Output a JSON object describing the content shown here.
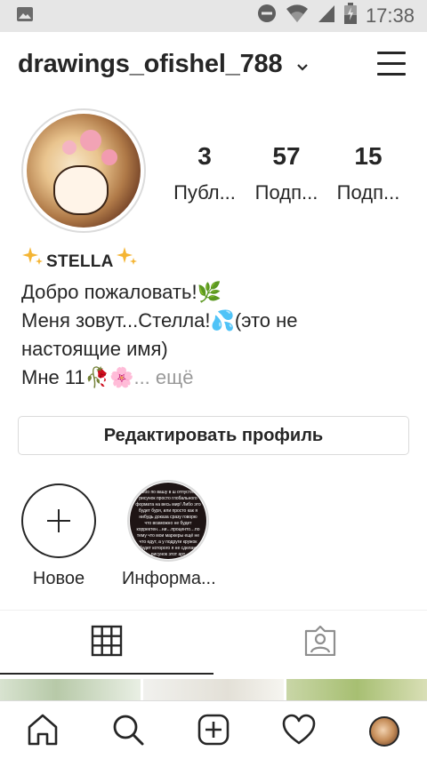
{
  "status_bar": {
    "time": "17:38",
    "icons": [
      "image-icon",
      "do-not-disturb-icon",
      "wifi-icon",
      "signal-icon",
      "battery-icon"
    ]
  },
  "header": {
    "username": "drawings_ofishel_788",
    "icons": [
      "chevron-down-icon",
      "menu-icon"
    ]
  },
  "profile": {
    "stats": [
      {
        "count": "3",
        "label": "Публ..."
      },
      {
        "count": "57",
        "label": "Подп..."
      },
      {
        "count": "15",
        "label": "Подп..."
      }
    ],
    "bio": {
      "name": "STELLA",
      "line1": "Добро пожаловать!🌿",
      "line2": "Меня зовут...Стелла!💦(это не",
      "line3": "настоящие имя)",
      "line4": "Мне 11🥀🌸",
      "more": "... ещё"
    },
    "edit_button": "Редактировать профиль"
  },
  "highlights": [
    {
      "label": "Новое",
      "icon": "plus-icon"
    },
    {
      "label": "Информа...",
      "cover_text": "Либо по вашу в ш отпустить рисунок просто глобального формата на весь мир! Либо это будет буря, или просто как я нибудь доказа сразу говорю что возможно не будет корректен…ни…проценто…по тему что мои маркеры ещё не что едут, а у подруги кружок будет которого я не сделаю рисунок этот арт"
    }
  ],
  "tabs": [
    {
      "name": "grid",
      "icon": "grid-icon",
      "active": true
    },
    {
      "name": "tagged",
      "icon": "tagged-person-icon",
      "active": false
    }
  ],
  "bottom_nav": [
    "home-icon",
    "search-icon",
    "new-post-icon",
    "heart-icon",
    "profile-avatar"
  ],
  "colors": {
    "text": "#262626",
    "muted": "#999999",
    "border": "#dbdbdb",
    "status_bar": "#e6e6e6"
  }
}
